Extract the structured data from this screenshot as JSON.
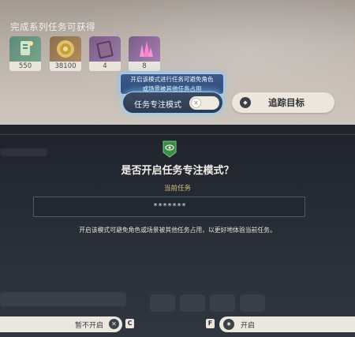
{
  "rewards": {
    "title": "完成系列任务可获得",
    "items": [
      {
        "count": "550",
        "icon": "adventure-exp-icon"
      },
      {
        "count": "38100",
        "icon": "mora-icon"
      },
      {
        "count": "4",
        "icon": "heros-wit-book-icon"
      },
      {
        "count": "8",
        "icon": "ore-crystal-icon"
      }
    ]
  },
  "tooltip": {
    "line1": "开启该模式进行任务可避免角色",
    "line2": "或场景被其他任务占用"
  },
  "focus_toggle": {
    "label": "任务专注模式",
    "knob_glyph": "✕"
  },
  "track_button": {
    "label": "追踪目标",
    "icon_glyph": "◆"
  },
  "modal": {
    "title": "是否开启任务专注模式？",
    "current_label": "当前任务",
    "current_task": "*******",
    "description": "开启该模式可避免角色或场景被其他任务占用，以更好地体验当前任务。"
  },
  "buttons": {
    "cancel_label": "暂不开启",
    "cancel_glyph": "✕",
    "cancel_key": "C",
    "confirm_key": "F",
    "confirm_glyph": "◉",
    "confirm_label": "开启"
  },
  "colors": {
    "accent_gold": "#d9c07a",
    "badge_green": "#3e8a4a",
    "glow_blue": "#8fd0ff"
  }
}
